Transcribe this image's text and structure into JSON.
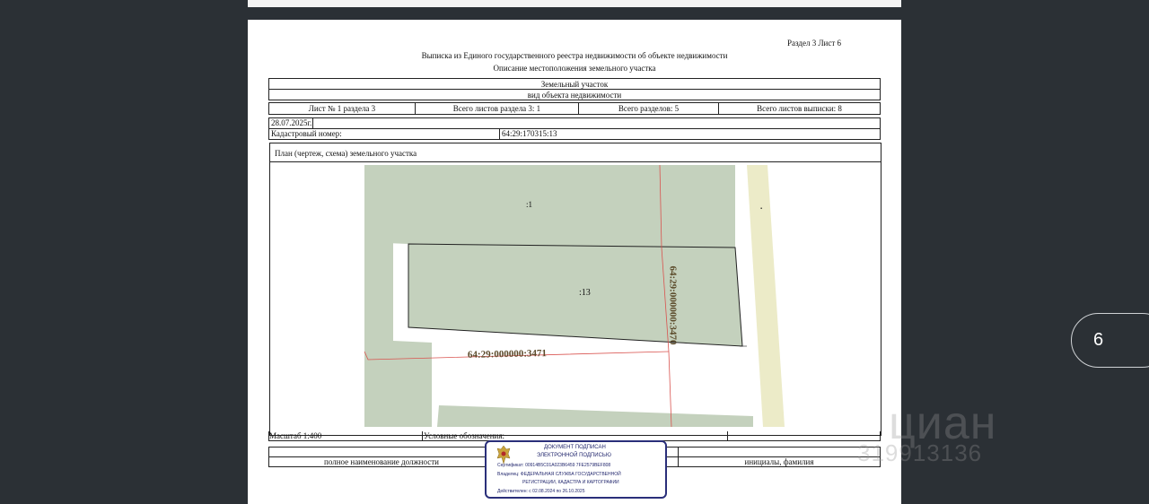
{
  "document": {
    "section_sheet": "Раздел 3   Лист 6",
    "title": "Выписка из Единого государственного реестра недвижимости об объекте недвижимости",
    "subtitle": "Описание местоположения земельного участка",
    "object_type": "Земельный участок",
    "object_type_caption": "вид объекта недвижимости",
    "sheet_info": [
      "Лист № 1 раздела 3",
      "Всего листов раздела 3: 1",
      "Всего разделов: 5",
      "Всего листов выписки: 8"
    ],
    "date": "28.07.2025г.",
    "cadastral_label": "Кадастровый номер:",
    "cadastral_number": "64:29:170315:13",
    "plan_title": "План (чертеж, схема) земельного участка",
    "map_labels": {
      "parcel_1": ":1",
      "parcel_13": ":13",
      "parcel_3471": "64:29:000000:3471",
      "parcel_3470": "64:29:000000:3470",
      "dot": "."
    },
    "scale": "Масштаб 1:400",
    "legend_label": "Условные обозначения:",
    "position_caption": "полное наименование должности",
    "initials_caption": "инициалы, фамилия"
  },
  "stamp": {
    "line1": "ДОКУМЕНТ ПОДПИСАН",
    "line2": "ЭЛЕКТРОННОЙ ПОДПИСЬЮ",
    "certificate": "Сертификат: 00914B5C01A023B6459 7FE2579BEF808",
    "owner": "Владелец: ФЕДЕРАЛЬНАЯ СЛУЖБА ГОСУДАРСТВЕННОЙ",
    "owner2": "РЕГИСТРАЦИИ, КАДАСТРА И КАРТОГРАФИИ",
    "valid": "Действителен: с 02.08.2024 по 26.10.2025"
  },
  "viewer": {
    "next_button_label": "6"
  },
  "watermark": {
    "brand": "циан",
    "phone": "319913136"
  },
  "colors": {
    "parcel_fill": "#c4d1bd",
    "road_fill": "#ecebc8",
    "boundary_red": "#d9534f",
    "stamp_blue": "#23286e",
    "background": "#2b3035"
  }
}
